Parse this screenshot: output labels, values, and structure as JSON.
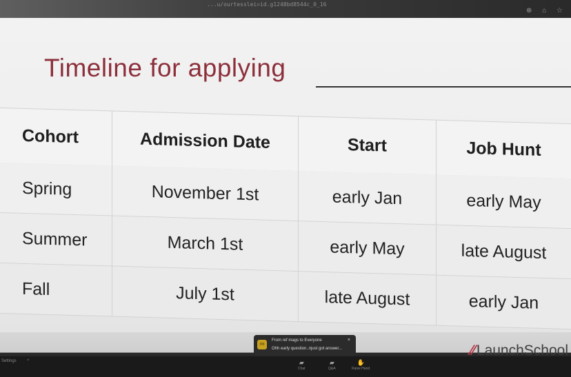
{
  "browser": {
    "url_fragment": "...u/ourtesslei=id.g1248bd8544c_0_16",
    "icons": "⊕ ⌂ ☆"
  },
  "slide": {
    "title": "Timeline for applying",
    "table": {
      "headers": [
        "Cohort",
        "Admission Date",
        "Start",
        "Job Hunt"
      ],
      "rows": [
        [
          "Spring",
          "November 1st",
          "early Jan",
          "early May"
        ],
        [
          "Summer",
          "March 1st",
          "early May",
          "late August"
        ],
        [
          "Fall",
          "July 1st",
          "late August",
          "early Jan"
        ]
      ]
    },
    "logo": {
      "mark": "⁄⁄",
      "text": "LaunchSchool"
    }
  },
  "chat_toast": {
    "avatar_initials": "rm",
    "from": "From ref mags to Everyone",
    "message": "Ohh early question..njust got answer...",
    "close": "×"
  },
  "zoom_bar": {
    "settings_label": "Settings",
    "settings_caret": "^",
    "items": [
      {
        "label": "Chat",
        "icon": "chat-icon"
      },
      {
        "label": "Q&A",
        "icon": "qa-icon"
      },
      {
        "label": "Raise Hand",
        "icon": "hand-icon"
      }
    ]
  }
}
